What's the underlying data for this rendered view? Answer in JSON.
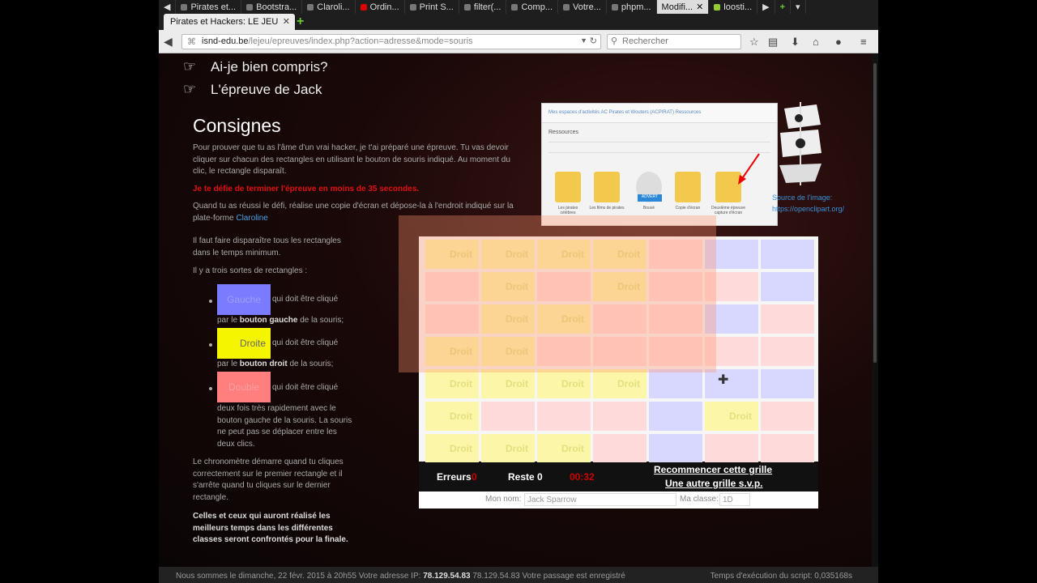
{
  "browser": {
    "tabs": [
      {
        "label": "Pirates et..."
      },
      {
        "label": "Bootstra..."
      },
      {
        "label": "Claroli..."
      },
      {
        "label": "Ordin..."
      },
      {
        "label": "Print S..."
      },
      {
        "label": "filter(..."
      },
      {
        "label": "Comp..."
      },
      {
        "label": "Votre..."
      },
      {
        "label": "phpm..."
      },
      {
        "label": "Modifi..."
      },
      {
        "label": "loosti..."
      }
    ],
    "active_tab": "Pirates et Hackers: LE JEU",
    "url_host": "isnd-edu.be",
    "url_path": "/lejeu/epreuves/index.php?action=adresse&mode=souris",
    "search_placeholder": "Rechercher"
  },
  "menu": [
    {
      "label": "Ai-je bien compris?"
    },
    {
      "label": "L'épreuve de Jack"
    }
  ],
  "consignes": {
    "title": "Consignes",
    "p1": "Pour prouver que tu as l'âme d'un vrai hacker, je t'ai préparé une épreuve. Tu vas devoir cliquer sur chacun des rectangles en utilisant le bouton de souris indiqué. Au moment du clic, le rectangle disparaît.",
    "defi": "Je te défie de terminer l'épreuve en moins de 35 secondes.",
    "p2": "Quand tu as réussi le défi, réalise une copie d'écran et dépose-la à l'endroit indiqué sur la plate-forme",
    "claroline": "Claroline",
    "p3": "Il faut faire disparaître tous les rectangles dans le temps minimum.",
    "p4": "Il y a trois sortes de rectangles :",
    "gauche_label": "Gauche",
    "gauche_text": "qui doit être cliqué",
    "gauche_sub_pre": "par le",
    "gauche_sub_bold": "bouton gauche",
    "gauche_sub_post": "de la souris;",
    "droite_label": "Droite",
    "droite_text": "qui doit être cliqué",
    "droite_sub_pre": "par le",
    "droite_sub_bold": "bouton droit",
    "droite_sub_post": "de la souris;",
    "double_label": "Double",
    "double_text": "qui doit être cliqué",
    "double_sub": "deux fois très rapidement avec le bouton gauche de la souris. La souris ne peut pas se déplacer entre les deux clics.",
    "p5": "Le chronomètre démarre quand tu cliques correctement sur le premier rectangle et il s'arrête quand tu cliques sur le dernier rectangle.",
    "p6": "Celles et ceux qui auront réalisé les meilleurs temps dans les différentes classes seront confrontés pour la finale."
  },
  "screenshot": {
    "breadcrumb": "Mes espaces d'activités   AC Pirates et Wouters (ACPIRAT)   Ressources",
    "resources": "Ressources",
    "folders": [
      {
        "label": "Les pirates célèbres"
      },
      {
        "label": "Les films de pirates"
      },
      {
        "label": "Bouvé"
      },
      {
        "label": "Copie d'écran"
      },
      {
        "label": "Deuxième épreuve capture d'écran"
      }
    ],
    "advert": "ADVERT"
  },
  "source": {
    "line1": "Source de l'image:",
    "line2": "https://openclipart.org/"
  },
  "game": {
    "droit": "Droit",
    "grid": [
      [
        "droite",
        "droite",
        "droite",
        "droite",
        "double",
        "gauche",
        "gauche"
      ],
      [
        "double",
        "droite",
        "double",
        "droite",
        "double",
        "double",
        "gauche"
      ],
      [
        "double",
        "droite",
        "droite",
        "double",
        "double",
        "gauche",
        "double"
      ],
      [
        "droite",
        "droite",
        "double",
        "double",
        "double",
        "double",
        "double"
      ],
      [
        "droite",
        "droite",
        "droite",
        "droite",
        "gauche",
        "gauche",
        "gauche"
      ],
      [
        "droite",
        "double",
        "double",
        "double",
        "gauche",
        "droite",
        "double"
      ],
      [
        "droite",
        "droite",
        "droite",
        "double",
        "gauche",
        "double",
        "double"
      ]
    ],
    "errors_label": "Erreurs",
    "errors_value": "0",
    "remaining_label": "Reste 0",
    "timer": "00:32",
    "restart": "Recommencer cette grille",
    "another": "Une autre grille s.v.p.",
    "name_label": "Mon nom:",
    "name_value": "Jack Sparrow",
    "class_label": "Ma classe:",
    "class_value": "1D"
  },
  "footer": {
    "left_pre": "Nous sommes le dimanche, 22 févr. 2015 à 20h55 Votre adresse IP:",
    "ip": "78.129.54.83",
    "left_post": "78.129.54.83 Votre passage est enregistré",
    "right": "Temps d'exécution du script: 0,035168s"
  }
}
